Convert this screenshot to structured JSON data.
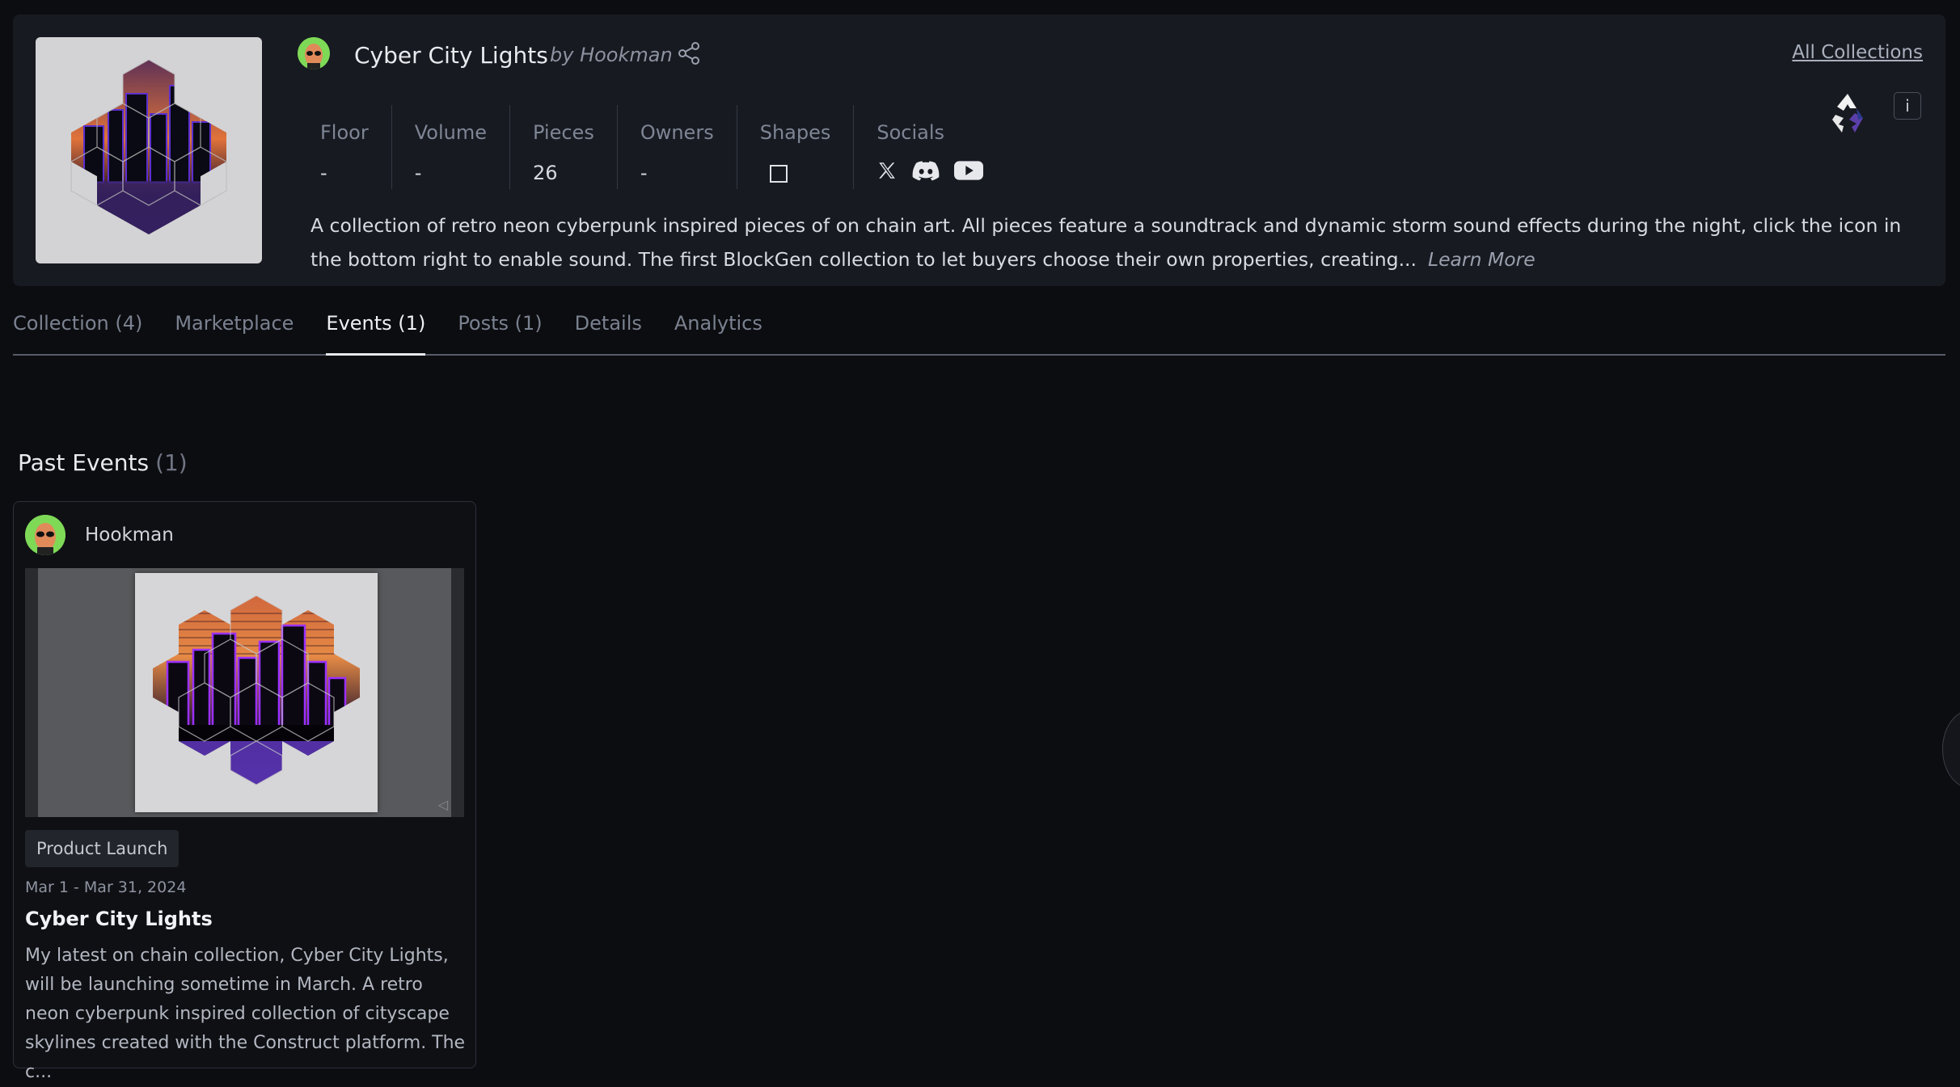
{
  "collection": {
    "title": "Cyber City Lights",
    "byline": "by Hookman",
    "all_collections": "All Collections",
    "info_label": "i",
    "stats": [
      {
        "label": "Floor",
        "value": "-"
      },
      {
        "label": "Volume",
        "value": "-"
      },
      {
        "label": "Pieces",
        "value": "26"
      },
      {
        "label": "Owners",
        "value": "-"
      }
    ],
    "shapes_label": "Shapes",
    "shapes_icon": "square-icon",
    "socials_label": "Socials",
    "socials": [
      "x-icon",
      "discord-icon",
      "youtube-icon"
    ],
    "description": "A collection of retro neon cyberpunk inspired pieces of on chain art. All pieces feature a soundtrack and dynamic storm sound effects during the night, click the icon in the bottom right to enable sound. The first BlockGen collection to let buyers choose their own properties, creating...",
    "learn_more": "Learn More"
  },
  "tabs": [
    {
      "label": "Collection (4)",
      "active": false
    },
    {
      "label": "Marketplace",
      "active": false
    },
    {
      "label": "Events (1)",
      "active": true
    },
    {
      "label": "Posts (1)",
      "active": false
    },
    {
      "label": "Details",
      "active": false
    },
    {
      "label": "Analytics",
      "active": false
    }
  ],
  "past_events": {
    "title": "Past Events",
    "count": "(1)",
    "events": [
      {
        "author": "Hookman",
        "tag": "Product Launch",
        "date": "Mar 1 - Mar 31, 2024",
        "title": "Cyber City Lights",
        "description": "My latest on chain collection, Cyber City Lights, will be launching sometime in March. A retro neon cyberpunk inspired collection of cityscape skylines created with the Construct platform. The c..."
      }
    ]
  },
  "colors": {
    "background": "#0c0d10",
    "card": "#171a21",
    "avatar": "#7ed957",
    "neon_purple": "#8a2be2",
    "sunset_orange": "#e0733a"
  }
}
